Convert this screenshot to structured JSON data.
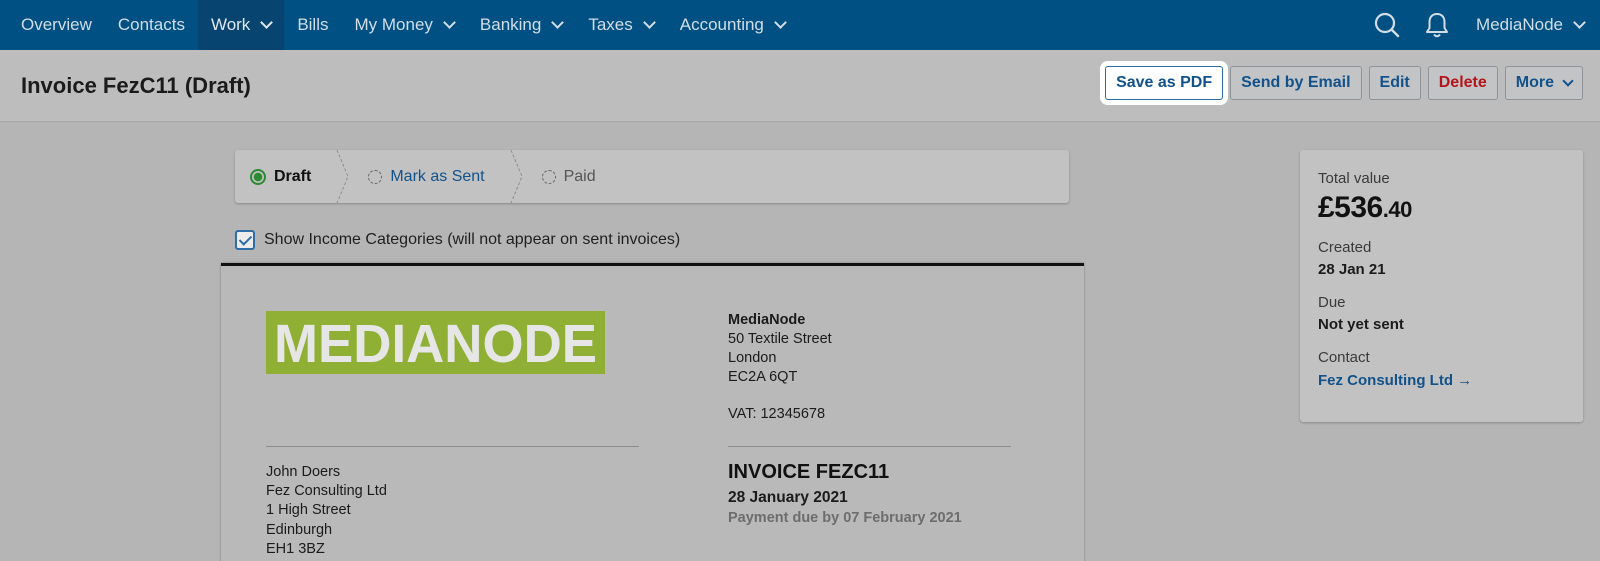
{
  "nav": {
    "items": [
      {
        "label": "Overview",
        "dropdown": false
      },
      {
        "label": "Contacts",
        "dropdown": false
      },
      {
        "label": "Work",
        "dropdown": true,
        "active": true
      },
      {
        "label": "Bills",
        "dropdown": false
      },
      {
        "label": "My Money",
        "dropdown": true
      },
      {
        "label": "Banking",
        "dropdown": true
      },
      {
        "label": "Taxes",
        "dropdown": true
      },
      {
        "label": "Accounting",
        "dropdown": true
      }
    ],
    "icons": [
      "search-icon",
      "bell-icon"
    ],
    "account_label": "MediaNode"
  },
  "header": {
    "title": "Invoice FezC11 (Draft)",
    "actions": {
      "save_pdf": "Save as PDF",
      "send_email": "Send by Email",
      "edit": "Edit",
      "delete": "Delete",
      "more": "More"
    }
  },
  "steps": {
    "draft": "Draft",
    "mark_sent": "Mark as Sent",
    "paid": "Paid"
  },
  "show_categories": {
    "checked": true,
    "label": "Show Income Categories (will not appear on sent invoices)"
  },
  "invoice": {
    "logo_text": "MEDIANODE",
    "sender": {
      "name": "MediaNode",
      "line1": "50 Textile Street",
      "line2": "London",
      "line3": "EC2A 6QT",
      "vat": "VAT: 12345678"
    },
    "recipient": {
      "line1": "John Doers",
      "line2": "Fez Consulting Ltd",
      "line3": "1 High Street",
      "line4": "Edinburgh",
      "line5": "EH1 3BZ"
    },
    "title": "INVOICE FEZC11",
    "date": "28 January 2021",
    "due": "Payment due by 07 February 2021"
  },
  "summary": {
    "total_label": "Total value",
    "total_main": "£536",
    "total_pence": ".40",
    "created_label": "Created",
    "created_value": "28 Jan 21",
    "due_label": "Due",
    "due_value": "Not yet sent",
    "contact_label": "Contact",
    "contact_value": "Fez Consulting Ltd →"
  },
  "colors": {
    "nav_bg": "#005083",
    "nav_active": "#074470",
    "accent": "#12528a",
    "danger": "#b3151b",
    "success": "#2c8a32",
    "logo_green": "#8fb034"
  }
}
